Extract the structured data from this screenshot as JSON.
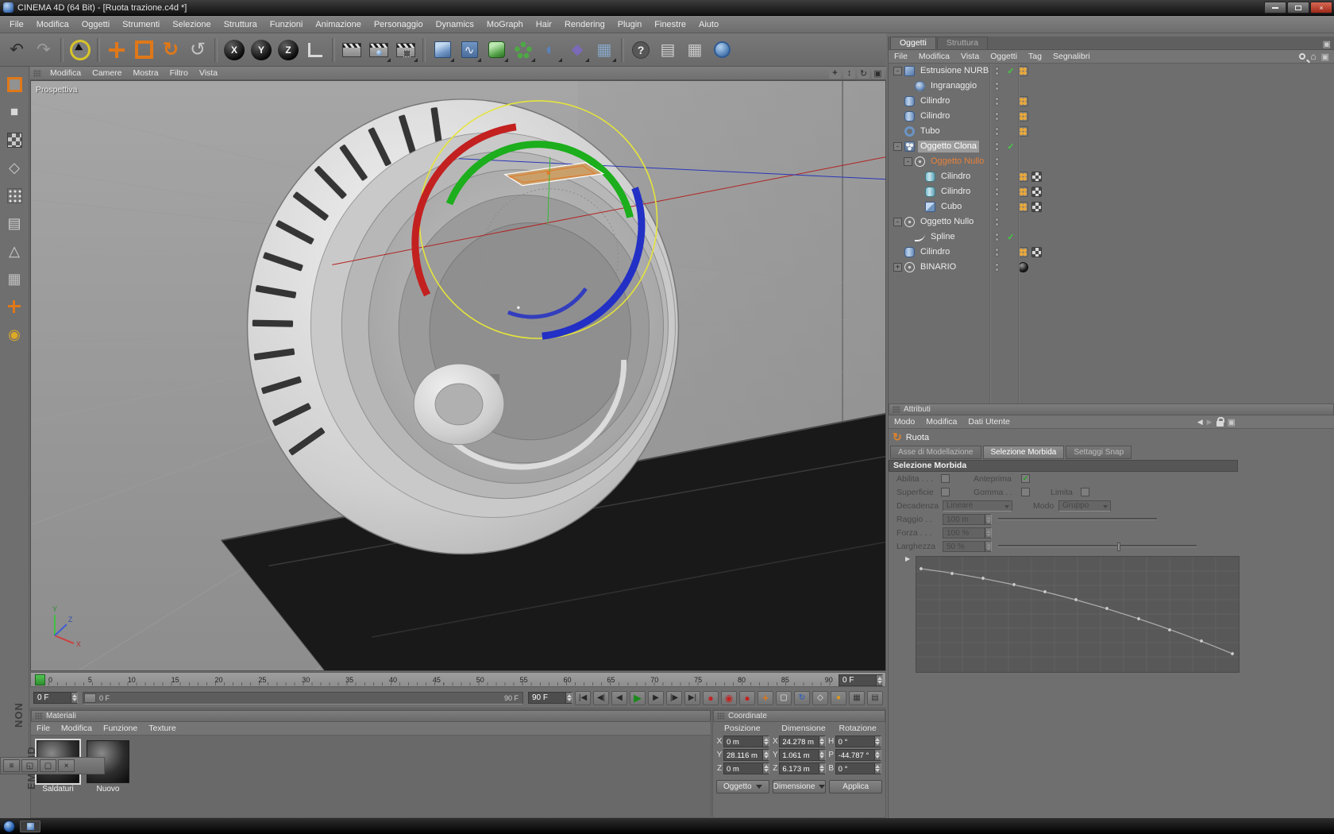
{
  "window": {
    "title": "CINEMA 4D (64 Bit) - [Ruota trazione.c4d *]",
    "watermark_top": "NON",
    "watermark_bottom": "EMA 4D"
  },
  "menubar": {
    "items": [
      "File",
      "Modifica",
      "Oggetti",
      "Strumenti",
      "Selezione",
      "Struttura",
      "Funzioni",
      "Animazione",
      "Personaggio",
      "Dynamics",
      "MoGraph",
      "Hair",
      "Rendering",
      "Plugin",
      "Finestre",
      "Aiuto"
    ]
  },
  "toolbar": {
    "axis_locks": [
      "X",
      "Y",
      "Z"
    ]
  },
  "viewport": {
    "menu": [
      "Modifica",
      "Camere",
      "Mostra",
      "Filtro",
      "Vista"
    ],
    "label": "Prospettiva",
    "axis": {
      "x": "X",
      "y": "Y",
      "z": "Z"
    }
  },
  "timeline": {
    "ticks": [
      "0",
      "5",
      "10",
      "15",
      "20",
      "25",
      "30",
      "35",
      "40",
      "45",
      "50",
      "55",
      "60",
      "65",
      "70",
      "75",
      "80",
      "85",
      "90"
    ],
    "end_box": "0 F"
  },
  "transport": {
    "current": "0 F",
    "range_start": "0 F",
    "range_end": "90 F",
    "end": "90 F"
  },
  "materials": {
    "title": "Materiali",
    "menu": [
      "File",
      "Modifica",
      "Funzione",
      "Texture"
    ],
    "items": [
      {
        "name": "Saldaturi",
        "cls": "sel"
      },
      {
        "name": "Nuovo",
        "cls": ""
      }
    ]
  },
  "coordinates": {
    "title": "Coordinate",
    "headers": [
      "Posizione",
      "Dimensione",
      "Rotazione"
    ],
    "rows": [
      {
        "a1": "X",
        "v1": "0 m",
        "a2": "X",
        "v2": "24.278 m",
        "a3": "H",
        "v3": "0 °"
      },
      {
        "a1": "Y",
        "v1": "28.116 m",
        "a2": "Y",
        "v2": "1.061 m",
        "a3": "P",
        "v3": "-44.787 °"
      },
      {
        "a1": "Z",
        "v1": "0 m",
        "a2": "Z",
        "v2": "6.173 m",
        "a3": "B",
        "v3": "0 °"
      }
    ],
    "buttons": {
      "object": "Oggetto",
      "size": "Dimensione",
      "apply": "Applica"
    }
  },
  "objects": {
    "tabs": [
      {
        "label": "Oggetti",
        "cls": "active"
      },
      {
        "label": "Struttura",
        "cls": ""
      }
    ],
    "menu": [
      "File",
      "Modifica",
      "Vista",
      "Oggetti",
      "Tag",
      "Segnalibri"
    ],
    "tree": [
      {
        "ind": "d0",
        "exp": "-",
        "icls": "nurbs",
        "label": "Estrusione NURBS",
        "lcls": "",
        "chk": "✓",
        "t1": "phong",
        "t2": ""
      },
      {
        "ind": "d1",
        "exp": "",
        "icls": "gear",
        "label": "Ingranaggio",
        "lcls": "",
        "chk": "",
        "t1": "",
        "t2": ""
      },
      {
        "ind": "d0",
        "exp": "",
        "icls": "cyl",
        "label": "Cilindro",
        "lcls": "",
        "chk": "",
        "t1": "phong",
        "t2": ""
      },
      {
        "ind": "d0",
        "exp": "",
        "icls": "cyl",
        "label": "Cilindro",
        "lcls": "",
        "chk": "",
        "t1": "phong",
        "t2": ""
      },
      {
        "ind": "d0",
        "exp": "",
        "icls": "tube",
        "label": "Tubo",
        "lcls": "",
        "chk": "",
        "t1": "phong",
        "t2": ""
      },
      {
        "ind": "d0",
        "exp": "-",
        "icls": "clone",
        "label": "Oggetto Clona",
        "lcls": "hl",
        "chk": "✓",
        "t1": "",
        "t2": ""
      },
      {
        "ind": "d1",
        "exp": "-",
        "icls": "nullo",
        "label": "Oggetto Nullo",
        "lcls": "act",
        "chk": "",
        "t1": "",
        "t2": ""
      },
      {
        "ind": "d2",
        "exp": "",
        "icls": "cyl2",
        "label": "Cilindro",
        "lcls": "",
        "chk": "",
        "t1": "phong",
        "t2": "mat"
      },
      {
        "ind": "d2",
        "exp": "",
        "icls": "cyl2",
        "label": "Cilindro",
        "lcls": "",
        "chk": "",
        "t1": "phong",
        "t2": "mat"
      },
      {
        "ind": "d2",
        "exp": "",
        "icls": "cube",
        "label": "Cubo",
        "lcls": "",
        "chk": "",
        "t1": "phong",
        "t2": "mat"
      },
      {
        "ind": "d0",
        "exp": "-",
        "icls": "nullo",
        "label": "Oggetto Nullo",
        "lcls": "",
        "chk": "",
        "t1": "",
        "t2": ""
      },
      {
        "ind": "d1",
        "exp": "",
        "icls": "spline",
        "label": "Spline",
        "lcls": "",
        "chk": "✓",
        "t1": "",
        "t2": ""
      },
      {
        "ind": "d0",
        "exp": "",
        "icls": "cyl",
        "label": "Cilindro",
        "lcls": "",
        "chk": "",
        "t1": "phong",
        "t2": "mat"
      },
      {
        "ind": "d0",
        "exp": "+",
        "icls": "nullo",
        "label": "BINARIO",
        "lcls": "",
        "chk": "",
        "t1": "sph",
        "t2": ""
      }
    ]
  },
  "attributes": {
    "title": "Attributi",
    "menu": [
      "Modo",
      "Modifica",
      "Dati Utente"
    ],
    "object_name": "Ruota",
    "tabs": [
      {
        "label": "Asse di Modellazione",
        "cls": ""
      },
      {
        "label": "Selezione Morbida",
        "cls": "active"
      },
      {
        "label": "Settaggi Snap",
        "cls": ""
      }
    ],
    "section": "Selezione Morbida",
    "labels": {
      "abilita": "Abilita . . .",
      "anteprima": "Anteprima",
      "superficie": "Superficie",
      "gomma": "Gomma . .",
      "limita": "Limita",
      "decadenza": "Decadenza",
      "modo": "Modo",
      "raggio": "Raggio . .",
      "forza": "Forza . . .",
      "larghezza": "Larghezza"
    },
    "values": {
      "decadenza": "Lineare",
      "modo": "Gruppo",
      "raggio": "100 m",
      "forza": "100 %",
      "larghezza": "50 %"
    },
    "anteprima_check": "✓"
  }
}
